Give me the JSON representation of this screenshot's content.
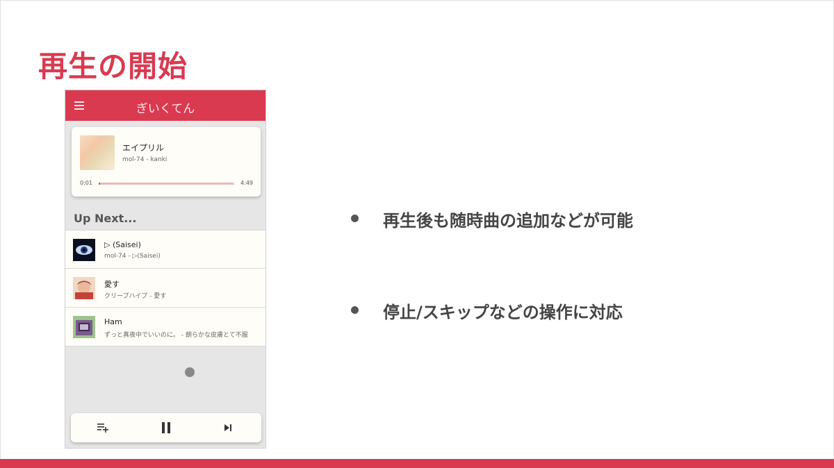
{
  "slide": {
    "title": "再生の開始",
    "accent_color": "#d93a50"
  },
  "app": {
    "title": "ぎいくてん",
    "menu_icon": "hamburger-menu-icon",
    "now_playing": {
      "title": "エイプリル",
      "subtitle": "mol-74 - kanki",
      "time_current": "0:01",
      "time_total": "4:49",
      "progress": 0.003
    },
    "up_next_label": "Up Next...",
    "queue": [
      {
        "title": "▷ (Saisei)",
        "subtitle": "mol-74 - ▷(Saisei)"
      },
      {
        "title": "愛す",
        "subtitle": "クリープハイプ - 愛す"
      },
      {
        "title": "Ham",
        "subtitle": "ずっと真夜中でいいのに。 - 朗らかな皮膚とて不服"
      }
    ],
    "controls": [
      "add-to-queue-icon",
      "pause-icon",
      "skip-next-icon"
    ]
  },
  "bullets": [
    "再生後も随時曲の追加などが可能",
    "停止/スキップなどの操作に対応"
  ]
}
